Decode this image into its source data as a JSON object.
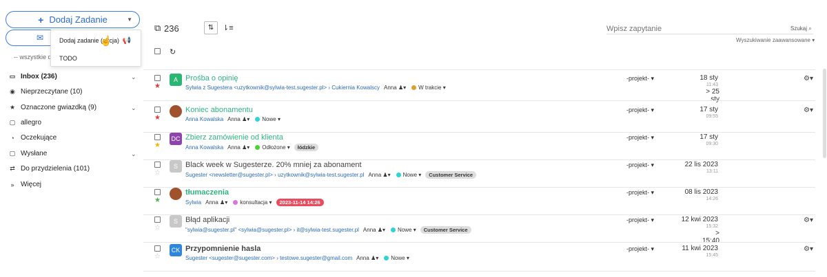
{
  "sidebar": {
    "add_task_label": "Dodaj Zadanie",
    "all_filter_label": "-- wszystkie dz",
    "dropdown": {
      "item1": "Dodaj zadanie (akcja)",
      "item2": "TODO"
    },
    "nav": [
      {
        "label": "Inbox (236)",
        "icon": "inbox-icon"
      },
      {
        "label": "Nieprzeczytane (10)",
        "icon": "eye-icon"
      },
      {
        "label": "Oznaczone gwiazdką (9)",
        "icon": "star-icon"
      },
      {
        "label": "allegro",
        "icon": "folder-icon"
      },
      {
        "label": "Oczekujące",
        "icon": "clock-icon"
      },
      {
        "label": "Wysłane",
        "icon": "folder-icon"
      },
      {
        "label": "Do przydzielenia (101)",
        "icon": "exchange-icon"
      },
      {
        "label": "Więcej",
        "icon": "double-chevron-icon"
      }
    ]
  },
  "toolbar": {
    "count": "236",
    "search_placeholder": "Wpisz zapytanie",
    "search_button": "Szukaj",
    "advanced_search": "Wyszukiwanie zaawansowane"
  },
  "rows": [
    {
      "subject": "Prośba o opinię",
      "avatar": "A",
      "avatar_color": "#2bb673",
      "star": "★",
      "star_color": "#e53935",
      "from": "Sylwia z Sugestera <uzytkownik@sylwia-test.sugester.pl> › Cukiernia Kowalscy",
      "assignee": "Anna",
      "status": "W trakcie",
      "status_color": "#e0a030",
      "tags": [],
      "project": "-projekt-",
      "date": "18 sty",
      "time": "11:43",
      "later": "> 25 sty"
    },
    {
      "subject": "Koniec abonamentu",
      "avatar": "",
      "avatar_color": "#a0522d",
      "star": "★",
      "star_color": "#e53935",
      "from": "Anna Kowalska",
      "assignee": "Anna",
      "status": "Nowe",
      "status_color": "#2fd3d3",
      "tags": [],
      "project": "-projekt-",
      "date": "17 sty",
      "time": "09:55",
      "later": ""
    },
    {
      "subject": "Zbierz zamówienie od klienta",
      "avatar": "DC",
      "avatar_color": "#8e44ad",
      "star": "★",
      "star_color": "#f5b400",
      "from": "Anna Kowalska",
      "assignee": "Anna",
      "status": "Odłożone",
      "status_color": "#4cd137",
      "tags": [
        "łódzkie"
      ],
      "project": "-projekt-",
      "date": "17 sty",
      "time": "09:30",
      "later": ""
    },
    {
      "subject": "Black week w Sugesterze. 20% mniej za abonament",
      "avatar": "S",
      "avatar_color": "#c8c8c8",
      "star": "☆",
      "star_color": "#bbb",
      "from": "Sugester <newsletter@sugester.pl> › uzytkownik@sylwia-test.sugester.pl",
      "assignee": "Anna",
      "status": "Nowe",
      "status_color": "#2fd3d3",
      "tags": [
        "Customer Service"
      ],
      "project": "-projekt-",
      "date": "22 lis 2023",
      "time": "13:11",
      "later": ""
    },
    {
      "subject": "tłumaczenia",
      "avatar": "",
      "avatar_color": "#a0522d",
      "star": "★",
      "star_color": "#4caf50",
      "from": "Sylwia",
      "assignee": "Anna",
      "status": "konsultacja",
      "status_color": "#d977d9",
      "tags": [
        "2023-11-14 14:26"
      ],
      "project": "-projekt-",
      "date": "08 lis 2023",
      "time": "14:26",
      "later": ""
    },
    {
      "subject": "Błąd aplikacji",
      "avatar": "S",
      "avatar_color": "#c8c8c8",
      "star": "☆",
      "star_color": "#bbb",
      "from": "\"sylwia@sugester.pl\" <sylwia@sugester.pl> › it@sylwia-test.sugester.pl",
      "assignee": "Anna",
      "status": "Nowe",
      "status_color": "#2fd3d3",
      "tags": [
        "Customer Service"
      ],
      "project": "-projekt-",
      "date": "12 kwi 2023",
      "time": "15:32",
      "later": "> 15:40"
    },
    {
      "subject": "Przypomnienie hasla",
      "avatar": "CK",
      "avatar_color": "#2e86de",
      "star": "☆",
      "star_color": "#bbb",
      "from": "Sugester <sugester@sugester.com> › testowe.sugester@gmail.com",
      "assignee": "Anna",
      "status": "Nowe",
      "status_color": "#2fd3d3",
      "tags": [],
      "project": "-projekt-",
      "date": "11 kwi 2023",
      "time": "15:45",
      "later": ""
    }
  ]
}
